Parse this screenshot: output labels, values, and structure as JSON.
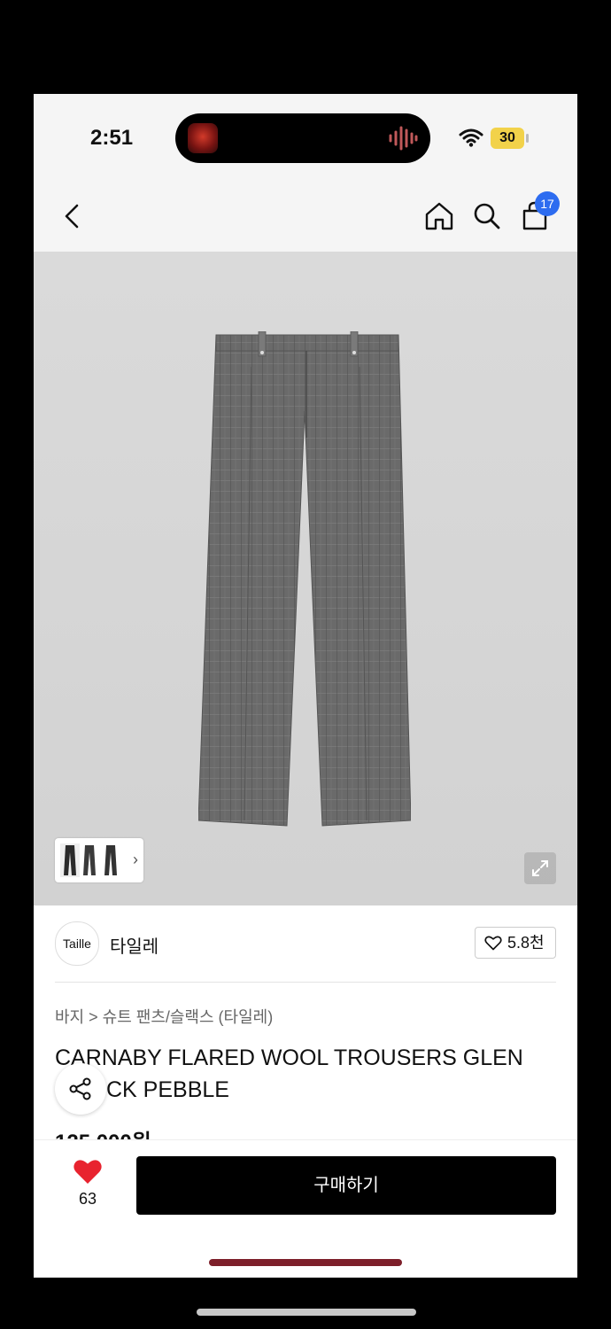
{
  "status_bar": {
    "time": "2:51",
    "battery": "30"
  },
  "nav": {
    "cart_count": "17"
  },
  "brand": {
    "logo_text": "Taille",
    "name": "타일레",
    "likes": "5.8천"
  },
  "product": {
    "breadcrumb": "바지 > 슈트 팬츠/슬랙스 (타일레)",
    "title_line1": "CARNABY FLARED WOOL TROUSERS GLEN",
    "title_line2": "CK PEBBLE",
    "price_partial": "125,000원"
  },
  "bottom_bar": {
    "wishlist_count": "63",
    "buy_label": "구매하기"
  },
  "colors": {
    "accent_blue": "#2d6cf0",
    "heart_red": "#e8232f",
    "battery_yellow": "#f2d24a"
  }
}
